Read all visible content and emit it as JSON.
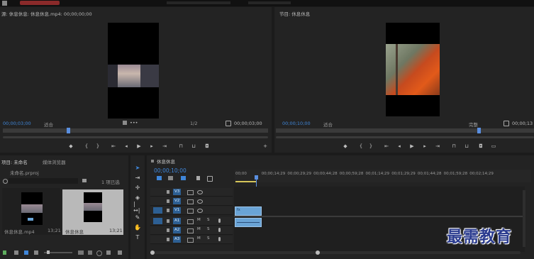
{
  "top_bar": {
    "menu_items": [
      "",
      "",
      "",
      "",
      ""
    ]
  },
  "source_monitor": {
    "tab_label": "源: 休息休息: 休息休息.mp4: 00;00;00;00",
    "timecode_current": "00;00;03;00",
    "fit_label": "适合",
    "fraction_label": "1/2",
    "timecode_end": "00;00;03;00",
    "playhead_fraction": 0.24
  },
  "program_monitor": {
    "tab_label": "节目: 休息休息",
    "timecode_current": "00;00;10;00",
    "fit_label": "适合",
    "full_label": "完整",
    "timecode_end": "00;00;13",
    "playhead_fraction": 0.78
  },
  "project_panel": {
    "tab_label": "项目: 未命名",
    "tab2_label": "媒体浏览器",
    "file_label": "未命名.prproj",
    "count_label": "1 项已选",
    "items": [
      {
        "name": "休息休息.mp4",
        "duration": "13;21"
      },
      {
        "name": "休息休息",
        "duration": "13;21"
      }
    ]
  },
  "timeline": {
    "tab_label": "休息休息",
    "timecode": "00;00;10;00",
    "ruler": [
      "00;00",
      "00;00;14;29",
      "00;00;29;29",
      "00;00;44;28",
      "00;00;59;28",
      "00;01;14;29",
      "00;01;29;29",
      "00;01;44;28",
      "00;01;59;28",
      "00;02;14;29"
    ],
    "video_tracks": [
      "V3",
      "V2",
      "V1"
    ],
    "audio_tracks": [
      "A1",
      "A2",
      "A3"
    ],
    "track_toggle_labels": [
      "M",
      "S"
    ]
  },
  "watermark": "最需教育",
  "colors": {
    "accent": "#3f86d9",
    "clip": "#6aa4d6",
    "playhead": "#5a8fe0",
    "watermark": "#2a3b8f"
  }
}
